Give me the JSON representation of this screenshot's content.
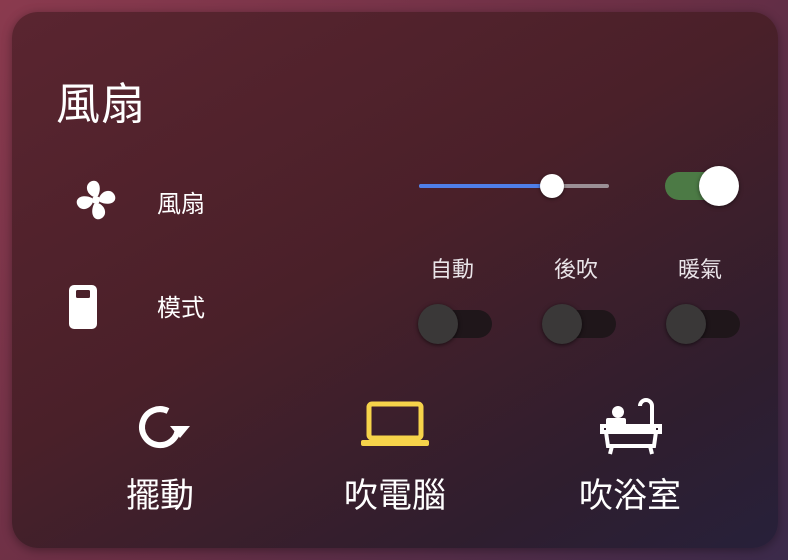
{
  "card": {
    "title": "風扇"
  },
  "fan_row": {
    "icon": "fan-icon",
    "label": "風扇",
    "speed_fraction": 0.7,
    "power_on": true
  },
  "mode_row": {
    "icon": "remote-icon",
    "label": "模式",
    "options": [
      {
        "label": "自動",
        "on": false
      },
      {
        "label": "後吹",
        "on": false
      },
      {
        "label": "暖氣",
        "on": false
      }
    ]
  },
  "actions": [
    {
      "label": "擺動",
      "icon": "rotate-icon",
      "color": "#ffffff"
    },
    {
      "label": "吹電腦",
      "icon": "laptop-icon",
      "color": "#f6d34a"
    },
    {
      "label": "吹浴室",
      "icon": "bathtub-icon",
      "color": "#ffffff"
    }
  ],
  "colors": {
    "slider_fill": "#4f7fe8",
    "toggle_on": "#4c7a45",
    "active_accent": "#f6d34a"
  }
}
